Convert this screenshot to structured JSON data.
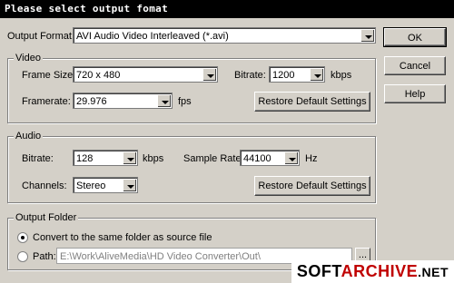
{
  "window": {
    "title": "Please select output fomat"
  },
  "output_format": {
    "label": "Output Format:",
    "value": "AVI Audio Video Interleaved (*.avi)"
  },
  "video": {
    "group_label": "Video",
    "frame_size_label": "Frame Size:",
    "frame_size_value": "720 x 480",
    "bitrate_label": "Bitrate:",
    "bitrate_value": "1200",
    "bitrate_unit": "kbps",
    "framerate_label": "Framerate:",
    "framerate_value": "29.976",
    "framerate_unit": "fps",
    "restore_label": "Restore Default Settings"
  },
  "audio": {
    "group_label": "Audio",
    "bitrate_label": "Bitrate:",
    "bitrate_value": "128",
    "bitrate_unit": "kbps",
    "sample_rate_label": "Sample Rate:",
    "sample_rate_value": "44100",
    "sample_rate_unit": "Hz",
    "channels_label": "Channels:",
    "channels_value": "Stereo",
    "restore_label": "Restore Default Settings"
  },
  "output_folder": {
    "group_label": "Output Folder",
    "same_folder_label": "Convert to the same folder as source file",
    "path_label": "Path:",
    "path_value": "E:\\Work\\AliveMedia\\HD Video Converter\\Out\\",
    "browse_label": "..."
  },
  "buttons": {
    "ok": "OK",
    "cancel": "Cancel",
    "help": "Help"
  },
  "watermark": {
    "part1": "SOFT",
    "part2": "ARCHIVE",
    "part3": ".NET"
  }
}
